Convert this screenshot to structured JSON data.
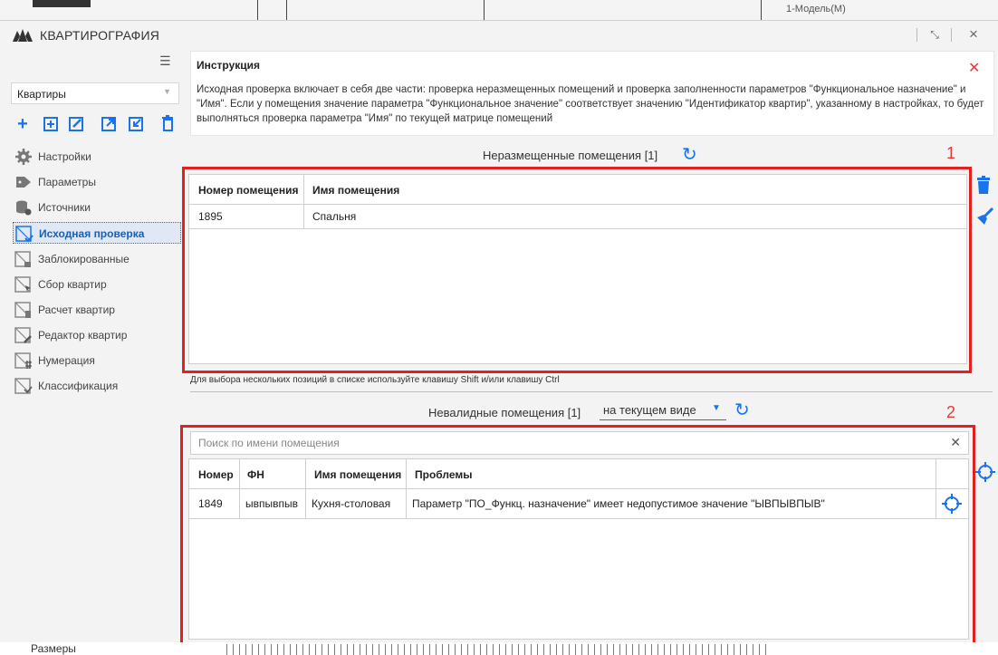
{
  "background": {
    "model_label": "1-Модель(M)",
    "bottom_label": "Размеры"
  },
  "window": {
    "title": "КВАРТИРОГРАФИЯ",
    "collapse_icon": "collapse-icon",
    "close_icon": "close-icon"
  },
  "sidebar": {
    "dropdown_value": "Квартиры",
    "toolbar": [
      "add-icon",
      "add-square-icon",
      "edit-icon",
      "export-icon",
      "import-icon",
      "delete-icon"
    ],
    "items": [
      {
        "label": "Настройки",
        "icon": "gear-icon"
      },
      {
        "label": "Параметры",
        "icon": "tag-icon"
      },
      {
        "label": "Источники",
        "icon": "database-icon"
      },
      {
        "label": "Исходная проверка",
        "icon": "check-plan-icon",
        "active": true
      },
      {
        "label": "Заблокированные",
        "icon": "lock-plan-icon"
      },
      {
        "label": "Сбор квартир",
        "icon": "cursor-plan-icon"
      },
      {
        "label": "Расчет квартир",
        "icon": "calc-plan-icon"
      },
      {
        "label": "Редактор квартир",
        "icon": "edit-plan-icon"
      },
      {
        "label": "Нумерация",
        "icon": "hash-plan-icon"
      },
      {
        "label": "Классификация",
        "icon": "classify-plan-icon"
      }
    ]
  },
  "instruction": {
    "title": "Инструкция",
    "text": "Исходная проверка включает в себя две части: проверка неразмещенных помещений и проверка заполненности параметров \"Функциональное назначение\" и \"Имя\". Если у помещения значение параметра \"Функциональное значение\" соответствует значению \"Идентификатор квартир\", указанному в настройках, то будет выполняться проверка параметра \"Имя\" по текущей матрице помещений"
  },
  "unplaced": {
    "title": "Неразмещенные помещения [1]",
    "marker": "1",
    "columns": [
      "Номер помещения",
      "Имя помещения"
    ],
    "rows": [
      [
        "1895",
        "Спальня"
      ]
    ],
    "hint": "Для выбора нескольких позиций в списке используйте клавишу Shift и/или клавишу Ctrl"
  },
  "invalid": {
    "title": "Невалидные помещения [1]",
    "scope": "на текущем виде",
    "marker": "2",
    "search_placeholder": "Поиск по имени помещения",
    "columns": [
      "Номер",
      "ФН",
      "Имя помещения",
      "Проблемы"
    ],
    "rows": [
      [
        "1849",
        "ывпывпыв",
        "Кухня-столовая",
        "Параметр \"ПО_Функц. назначение\" имеет недопустимое значение \"ЫВПЫВПЫВ\""
      ]
    ]
  },
  "colors": {
    "accent": "#1a73e8",
    "highlight": "#e32020",
    "panel_bg": "#f3f3f3"
  }
}
